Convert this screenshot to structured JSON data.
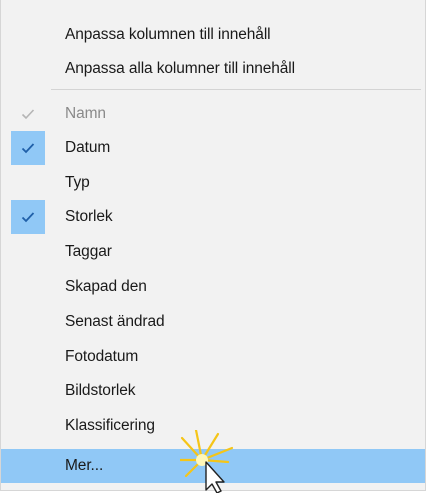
{
  "menu": {
    "top_items": [
      {
        "label": "Anpassa kolumnen till innehåll"
      },
      {
        "label": "Anpassa alla kolumner till innehåll"
      }
    ],
    "columns": [
      {
        "label": "Namn",
        "checked": true,
        "disabled": true
      },
      {
        "label": "Datum",
        "checked": true,
        "disabled": false
      },
      {
        "label": "Typ",
        "checked": false,
        "disabled": false
      },
      {
        "label": "Storlek",
        "checked": true,
        "disabled": false
      },
      {
        "label": "Taggar",
        "checked": false,
        "disabled": false
      },
      {
        "label": "Skapad den",
        "checked": false,
        "disabled": false
      },
      {
        "label": "Senast ändrad",
        "checked": false,
        "disabled": false
      },
      {
        "label": "Fotodatum",
        "checked": false,
        "disabled": false
      },
      {
        "label": "Bildstorlek",
        "checked": false,
        "disabled": false
      },
      {
        "label": "Klassificering",
        "checked": false,
        "disabled": false
      }
    ],
    "more": {
      "label": "Mer...",
      "highlighted": true
    }
  },
  "colors": {
    "highlight": "#90c8f6",
    "check_enabled": "#1f5fa8",
    "check_disabled": "#b5b5b5",
    "background": "#f2f2f2"
  }
}
